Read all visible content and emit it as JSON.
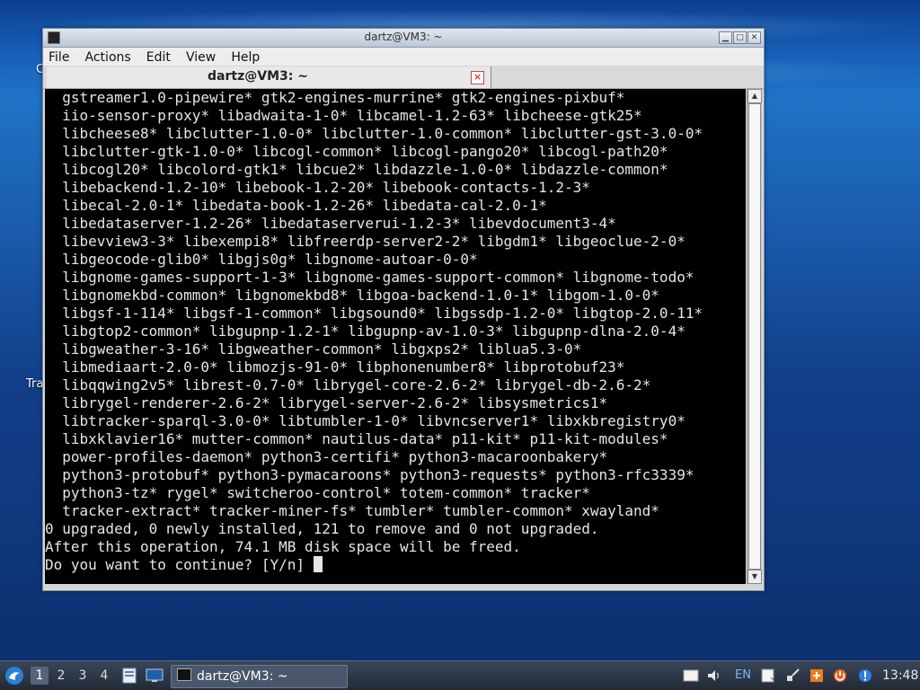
{
  "desktop": {
    "icons": [
      "C",
      "Tra"
    ]
  },
  "window": {
    "title": "dartz@VM3: ~",
    "buttons": {
      "minimize": "▁",
      "maximize": "□",
      "close": "✕"
    },
    "menu": [
      "File",
      "Actions",
      "Edit",
      "View",
      "Help"
    ],
    "tab": {
      "label": "dartz@VM3: ~",
      "close": "×"
    }
  },
  "terminal": {
    "lines": [
      "  gstreamer1.0-pipewire* gtk2-engines-murrine* gtk2-engines-pixbuf*",
      "  iio-sensor-proxy* libadwaita-1-0* libcamel-1.2-63* libcheese-gtk25*",
      "  libcheese8* libclutter-1.0-0* libclutter-1.0-common* libclutter-gst-3.0-0*",
      "  libclutter-gtk-1.0-0* libcogl-common* libcogl-pango20* libcogl-path20*",
      "  libcogl20* libcolord-gtk1* libcue2* libdazzle-1.0-0* libdazzle-common*",
      "  libebackend-1.2-10* libebook-1.2-20* libebook-contacts-1.2-3*",
      "  libecal-2.0-1* libedata-book-1.2-26* libedata-cal-2.0-1*",
      "  libedataserver-1.2-26* libedataserverui-1.2-3* libevdocument3-4*",
      "  libevview3-3* libexempi8* libfreerdp-server2-2* libgdm1* libgeoclue-2-0*",
      "  libgeocode-glib0* libgjs0g* libgnome-autoar-0-0*",
      "  libgnome-games-support-1-3* libgnome-games-support-common* libgnome-todo*",
      "  libgnomekbd-common* libgnomekbd8* libgoa-backend-1.0-1* libgom-1.0-0*",
      "  libgsf-1-114* libgsf-1-common* libgsound0* libgssdp-1.2-0* libgtop-2.0-11*",
      "  libgtop2-common* libgupnp-1.2-1* libgupnp-av-1.0-3* libgupnp-dlna-2.0-4*",
      "  libgweather-3-16* libgweather-common* libgxps2* liblua5.3-0*",
      "  libmediaart-2.0-0* libmozjs-91-0* libphonenumber8* libprotobuf23*",
      "  libqqwing2v5* librest-0.7-0* librygel-core-2.6-2* librygel-db-2.6-2*",
      "  librygel-renderer-2.6-2* librygel-server-2.6-2* libsysmetrics1*",
      "  libtracker-sparql-3.0-0* libtumbler-1-0* libvncserver1* libxkbregistry0*",
      "  libxklavier16* mutter-common* nautilus-data* p11-kit* p11-kit-modules*",
      "  power-profiles-daemon* python3-certifi* python3-macaroonbakery*",
      "  python3-protobuf* python3-pymacaroons* python3-requests* python3-rfc3339*",
      "  python3-tz* rygel* switcheroo-control* totem-common* tracker*",
      "  tracker-extract* tracker-miner-fs* tumbler* tumbler-common* xwayland*",
      "0 upgraded, 0 newly installed, 121 to remove and 0 not upgraded.",
      "After this operation, 74.1 MB disk space will be freed."
    ],
    "prompt": "Do you want to continue? [Y/n] "
  },
  "taskbar": {
    "workspaces": [
      "1",
      "2",
      "3",
      "4"
    ],
    "task_label": "dartz@VM3: ~",
    "keyboard_layout": "EN",
    "clock": "13:48"
  }
}
